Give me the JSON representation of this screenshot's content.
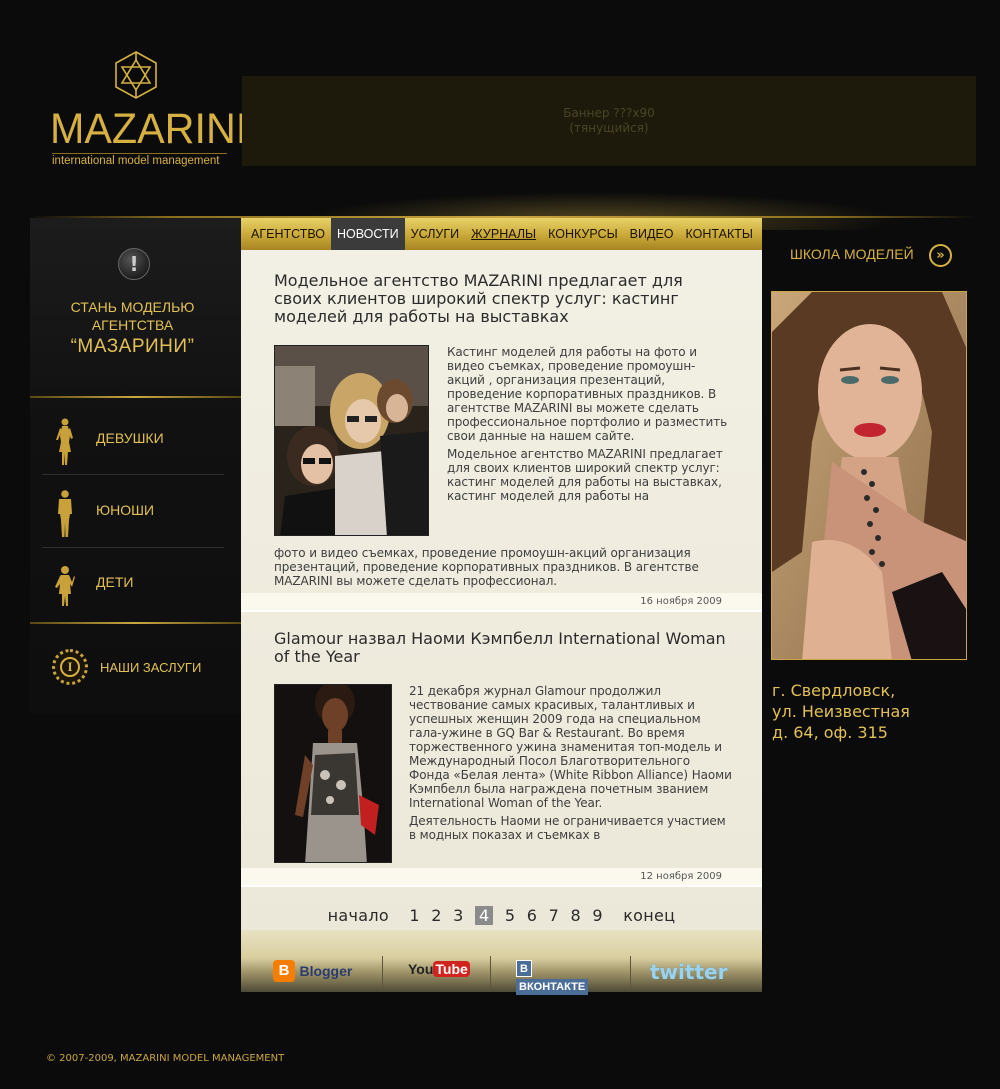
{
  "logo": {
    "name": "MAZARINI",
    "tagline": "international model management"
  },
  "banner": {
    "line1": "Баннер ???x90",
    "line2": "(тянущийся)"
  },
  "left": {
    "become_line1": "СТАНЬ МОДЕЛЬЮ",
    "become_line2": "АГЕНТСТВА",
    "become_line3": "“МАЗАРИНИ”",
    "items": [
      {
        "label": "ДЕВУШКИ",
        "icon": "woman-silhouette-icon"
      },
      {
        "label": "ЮНОШИ",
        "icon": "man-silhouette-icon"
      },
      {
        "label": "ДЕТИ",
        "icon": "child-silhouette-icon"
      }
    ],
    "merits": "НАШИ ЗАСЛУГИ"
  },
  "nav": {
    "items": [
      "АГЕНТСТВО",
      "НОВОСТИ",
      "УСЛУГИ",
      "ЖУРНАЛЫ",
      "КОНКУРСЫ",
      "ВИДЕО",
      "КОНТАКТЫ"
    ],
    "active": "НОВОСТИ"
  },
  "articles": [
    {
      "title": "Модельное агентство MAZARINI предлагает для своих клиентов широкий спектр услуг: кастинг моделей для работы на выставках",
      "p1": "Кастинг моделей для работы на фото и видео съемках, проведение промоушн-акций , организация презентаций, проведение корпоративных праздников. В агентстве MAZARINI вы можете сделать профессиональное портфолио и разместить свои данные на нашем сайте.",
      "p2": "Модельное агентство MAZARINI предлагает для своих клиентов широкий спектр услуг: кастинг моделей для работы на выставках, кастинг моделей для работы на",
      "p3": "фото и видео съемках, проведение промоушн-акций организация презентаций, проведение корпоративных праздников. В агентстве MAZARINI вы можете сделать профессионал.",
      "date": "16 ноября 2009"
    },
    {
      "title": "Glamour назвал Наоми Кэмпбелл International Woman of the Year",
      "p1": "21 декабря журнал Glamour продолжил чествование самых красивых, талантливых и успешных женщин 2009 года на специальном гала-ужине в GQ Bar & Restaurant. Во время торжественного ужина знаменитая топ-модель и Международный Посол Благотворительного Фонда «Белая лента» (White Ribbon Alliance) Наоми Кэмпбелл была награждена почетным званием International Woman of the Year.",
      "p2": "Деятельность Наоми не ограничивается участием в модных показах и съемках в",
      "date": "12 ноября 2009"
    }
  ],
  "pager": {
    "first": "начало",
    "pages": [
      "1",
      "2",
      "3",
      "4",
      "5",
      "6",
      "7",
      "8",
      "9"
    ],
    "current": "4",
    "last": "конец"
  },
  "social": {
    "blogger": "Blogger",
    "youtube_you": "You",
    "youtube_tube": "Tube",
    "vk": "ВКОНТАКТЕ",
    "twitter": "twitter"
  },
  "right": {
    "school": "ШКОЛА МОДЕЛЕЙ",
    "address_line1": "г. Свердловск,",
    "address_line2": "ул. Неизвестная",
    "address_line3": "д. 64, оф. 315"
  },
  "footer": {
    "copyright": "© 2007-2009, MAZARINI MODEL MANAGEMENT"
  }
}
